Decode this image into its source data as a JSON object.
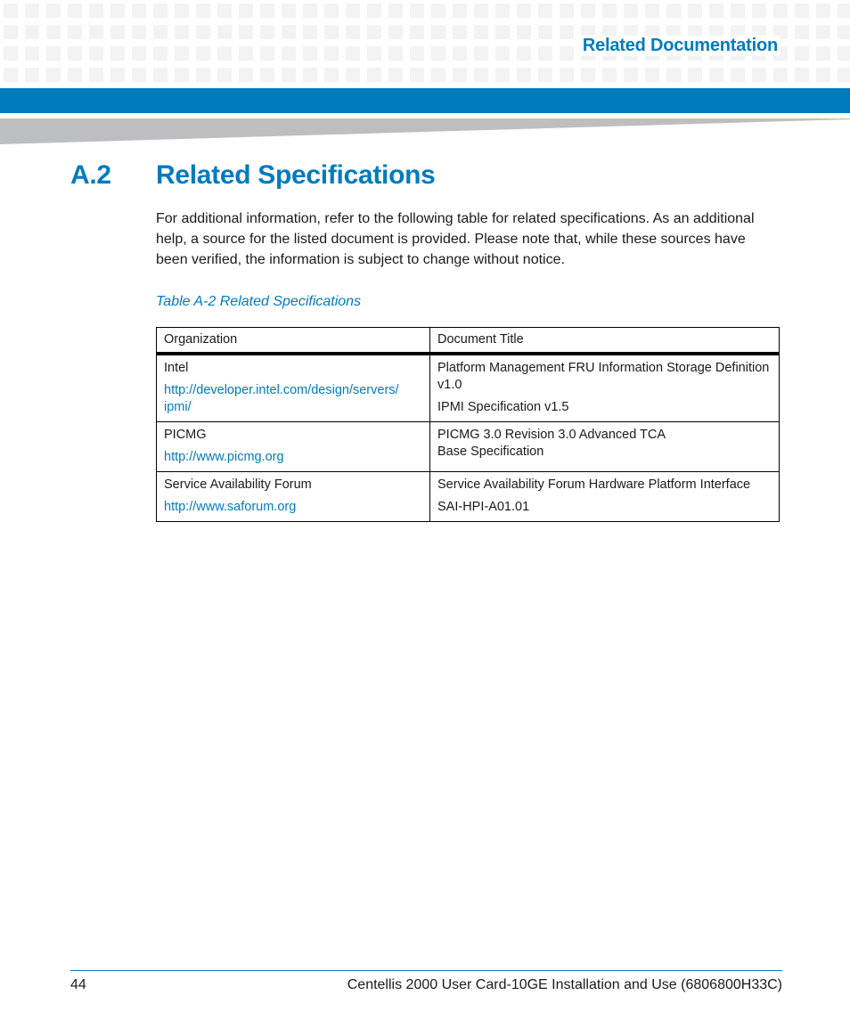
{
  "header": {
    "section_title": "Related Documentation",
    "accent_color": "#027bbd"
  },
  "section": {
    "number": "A.2",
    "title": "Related Specifications"
  },
  "intro_text": "For additional information, refer to the following table for related specifications. As an additional help, a source for the listed document is provided. Please note that, while these sources have been verified, the information is subject to change without notice.",
  "table": {
    "caption": "Table A-2 Related Specifications",
    "columns": [
      "Organization",
      "Document Title"
    ],
    "rows": [
      {
        "organization": "Intel",
        "url": "http://developer.intel.com/design/servers/ipmi/",
        "url_line1": "http://developer.intel.com/design/servers/",
        "url_line2": "ipmi/",
        "documents": [
          "Platform Management FRU Information Storage Definition v1.0",
          "IPMI Specification v1.5"
        ]
      },
      {
        "organization": "PICMG",
        "url": "http://www.picmg.org",
        "documents": [
          "PICMG 3.0 Revision 3.0 Advanced TCA Base Specification"
        ]
      },
      {
        "organization": "Service Availability Forum",
        "url": "http://www.saforum.org",
        "documents": [
          "Service Availability Forum Hardware Platform Interface",
          "SAI-HPI-A01.01"
        ]
      }
    ]
  },
  "footer": {
    "page_number": "44",
    "document_title": "Centellis 2000 User Card-10GE Installation and Use (6806800H33C)"
  }
}
